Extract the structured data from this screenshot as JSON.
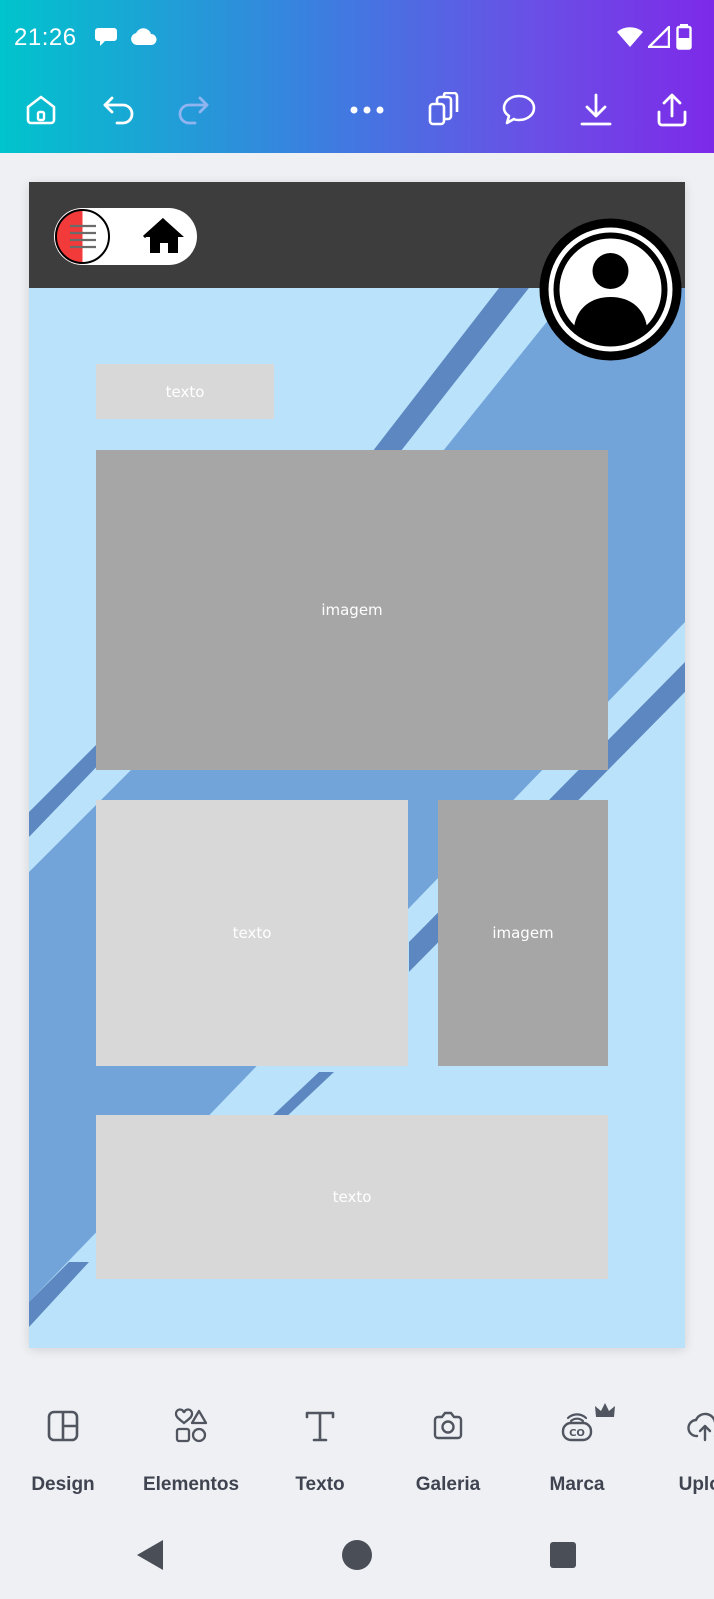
{
  "status_bar": {
    "time": "21:26",
    "icons": [
      "chat-notification-icon",
      "cloud-icon",
      "wifi-icon",
      "signal-icon",
      "battery-icon"
    ]
  },
  "toolbar": {
    "buttons": [
      "home-icon",
      "undo-icon",
      "redo-icon",
      "more-icon",
      "copy-pages-icon",
      "comment-icon",
      "download-icon",
      "share-icon"
    ]
  },
  "canvas": {
    "background_colors": {
      "light": "#bae3fb",
      "medium": "#73a4d9",
      "navbar": "#3d3d3d"
    },
    "blocks": [
      {
        "label": "texto",
        "kind": "text-placeholder"
      },
      {
        "label": "imagem",
        "kind": "image-placeholder"
      },
      {
        "label": "texto",
        "kind": "text-placeholder"
      },
      {
        "label": "imagem",
        "kind": "image-placeholder"
      },
      {
        "label": "texto",
        "kind": "text-placeholder"
      }
    ]
  },
  "tools": [
    {
      "label": "Design",
      "icon": "layout-icon"
    },
    {
      "label": "Elementos",
      "icon": "shapes-icon"
    },
    {
      "label": "Texto",
      "icon": "text-icon"
    },
    {
      "label": "Galeria",
      "icon": "camera-icon"
    },
    {
      "label": "Marca",
      "icon": "brand-icon",
      "premium": true
    },
    {
      "label": "Uploa",
      "icon": "upload-icon"
    }
  ],
  "colors": {
    "gradient_start": "#00c4cc",
    "gradient_end": "#7d2ae8",
    "placeholder_light": "#d8d8d8",
    "placeholder_dark": "#a6a6a6",
    "menu_red": "#f23a3a"
  }
}
